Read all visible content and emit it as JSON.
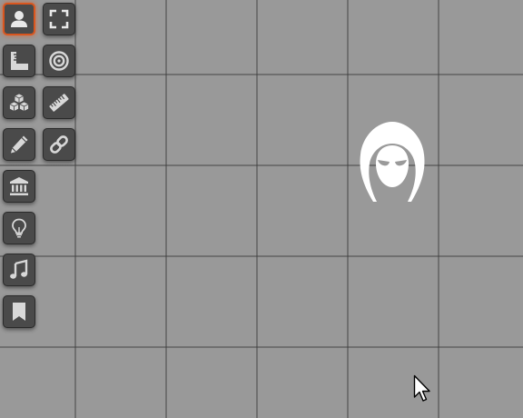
{
  "toolbar": {
    "tools": [
      {
        "icon": "user-icon",
        "active": true
      },
      {
        "icon": "fullscreen-icon",
        "active": false
      },
      {
        "icon": "set-square-icon",
        "active": false
      },
      {
        "icon": "target-icon",
        "active": false
      },
      {
        "icon": "cubes-icon",
        "active": false
      },
      {
        "icon": "ruler-icon",
        "active": false
      },
      {
        "icon": "pencil-icon",
        "active": false
      },
      {
        "icon": "link-icon",
        "active": false
      },
      {
        "icon": "bank-icon",
        "active": false
      },
      {
        "icon": "lightbulb-icon",
        "active": false
      },
      {
        "icon": "music-note-icon",
        "active": false
      },
      {
        "icon": "bookmark-icon",
        "active": false
      }
    ]
  },
  "map": {
    "grid": true,
    "background_color": "#999999",
    "token": {
      "icon": "hooded-figure-icon",
      "color": "#ffffff"
    }
  },
  "colors": {
    "button_bg": "#4a4a4a",
    "icon": "#d8d8d8",
    "active_border": "#d9561f"
  }
}
